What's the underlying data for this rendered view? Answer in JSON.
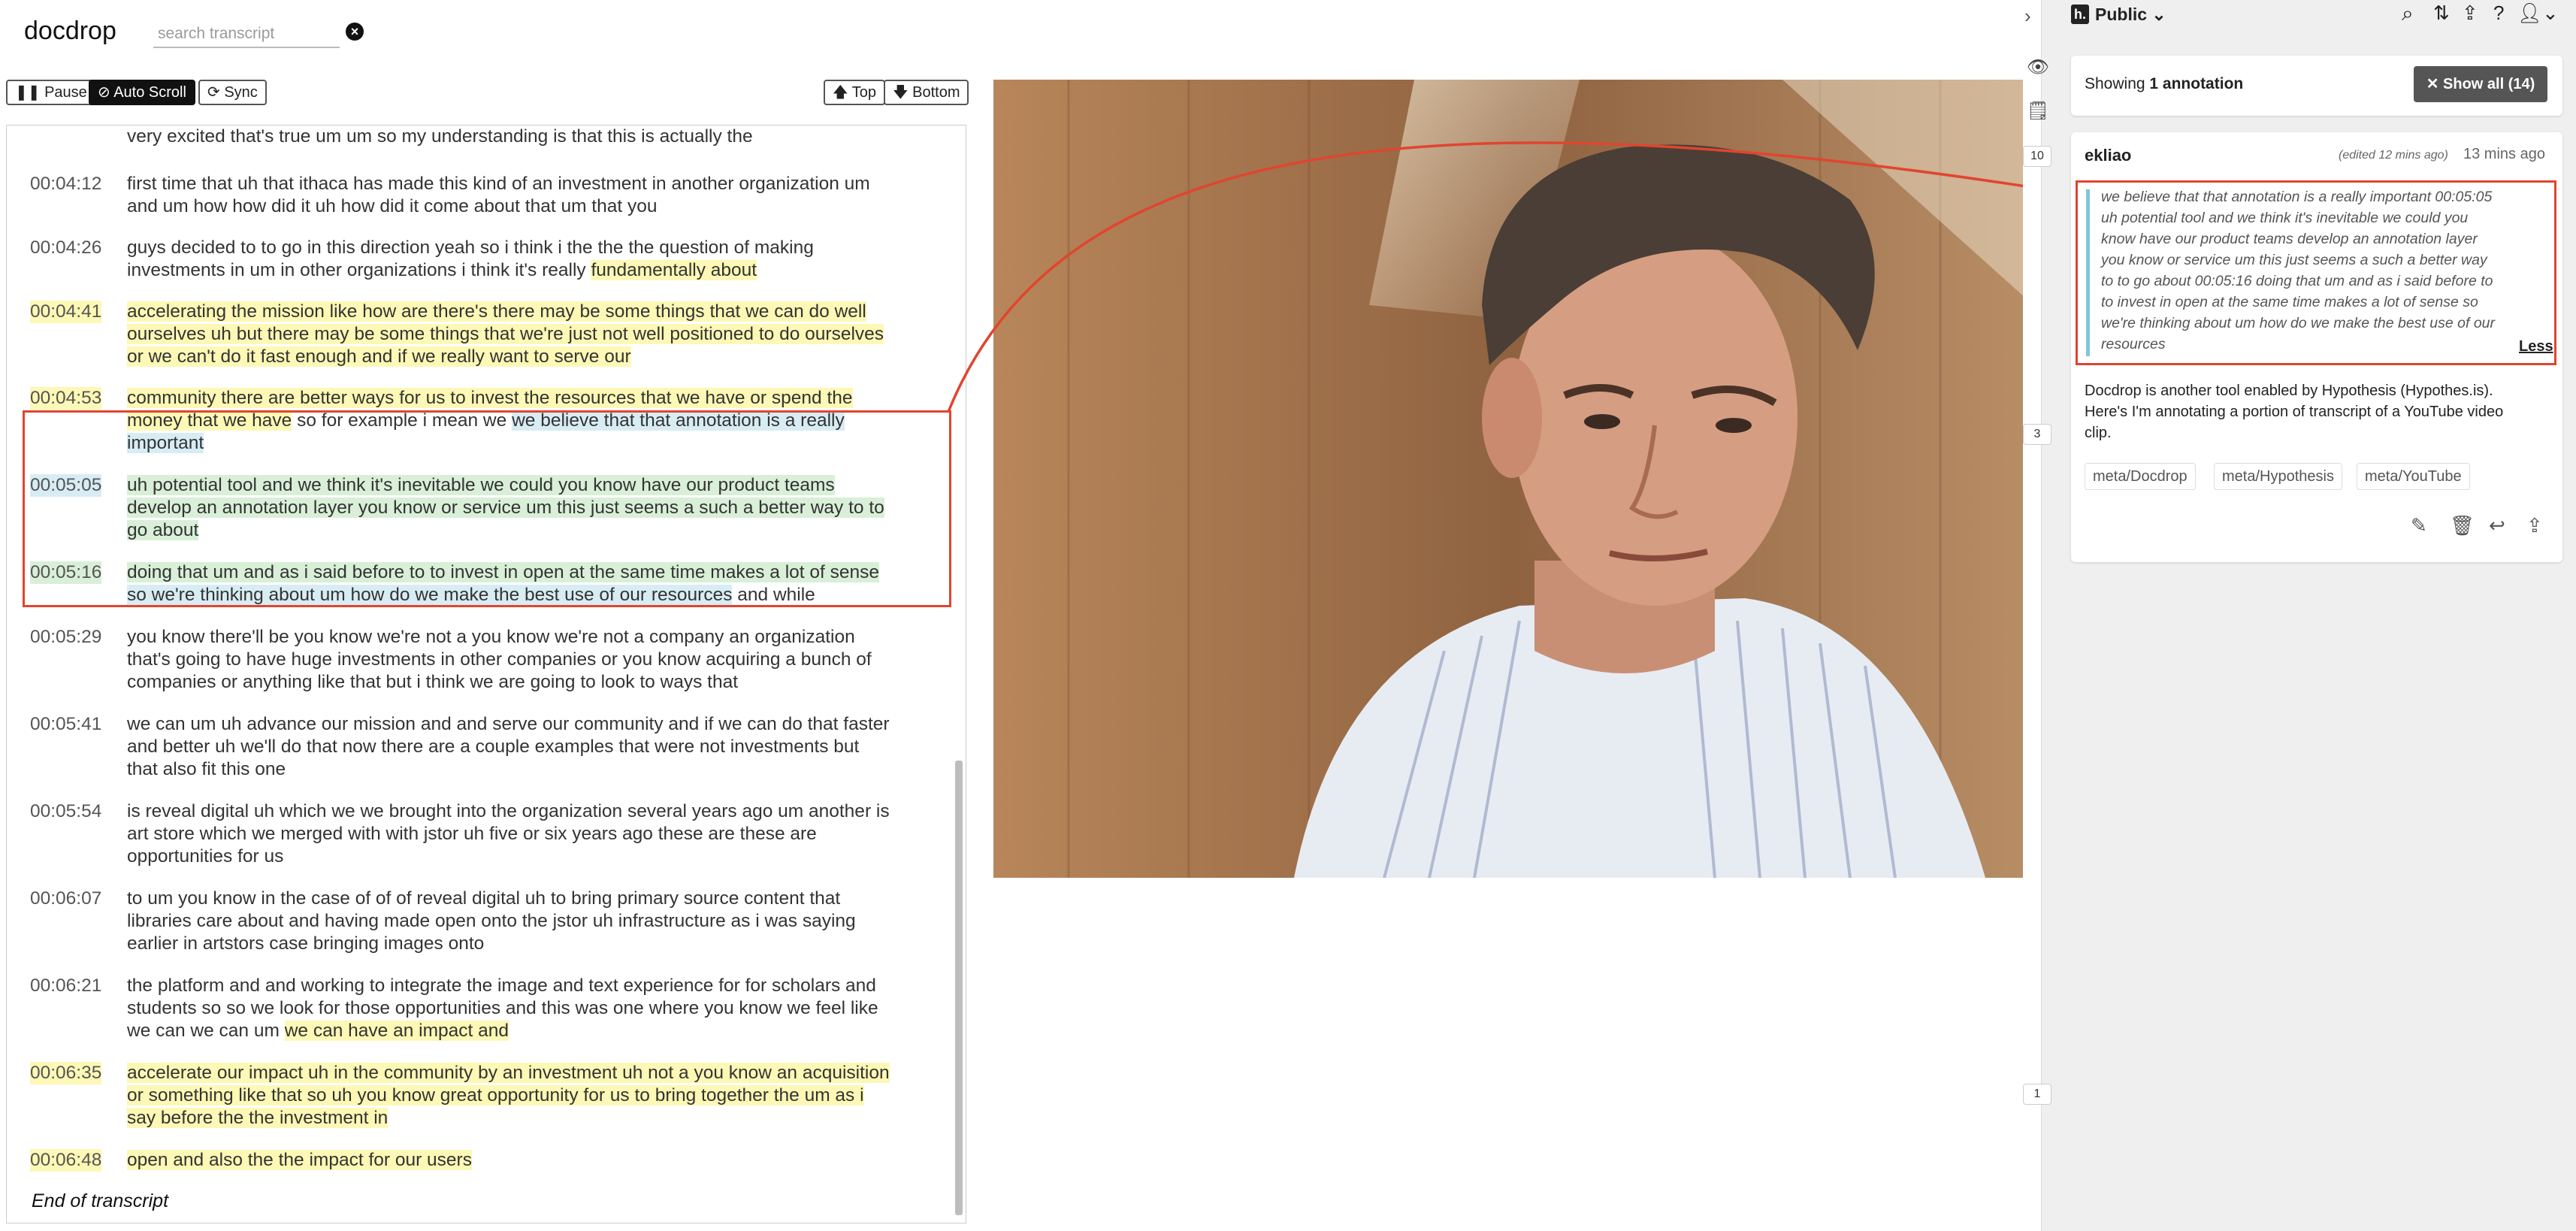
{
  "app": {
    "title": "docdrop",
    "search_placeholder": "search transcript"
  },
  "controls": {
    "pause": "Pause",
    "auto_scroll": "Auto Scroll",
    "sync": "Sync",
    "top": "Top",
    "bottom": "Bottom"
  },
  "transcript": {
    "partial_line": "very excited that's true um um so my understanding is that this is actually the",
    "segments": [
      {
        "time": "00:04:12",
        "lines": [
          "first time that uh that ithaca has made this kind of an investment in another organization um",
          "and um how how did it uh how did it come about that um that you"
        ]
      },
      {
        "time": "00:04:26",
        "lines": [
          "guys decided to to go in this direction yeah so i think i the the the question of making",
          "investments in um in other organizations i think it's really fundamentally about"
        ]
      },
      {
        "time": "00:04:41",
        "lines": [
          "accelerating the mission like how are there's there may be some things that we can do well",
          "ourselves uh but there may be some things that we're just not well positioned to do ourselves",
          "or we can't do it fast enough and if we really want to serve our"
        ]
      },
      {
        "time": "00:04:53",
        "lines": [
          "community there are better ways for us to invest the resources that we have or spend the",
          "money that we have so for example i mean we we believe that that annotation is a really",
          "important"
        ]
      },
      {
        "time": "00:05:05",
        "lines": [
          "uh potential tool and we think it's inevitable we could you know have our product teams",
          "develop an annotation layer you know or service um this just seems a such a better way to to",
          "go about"
        ]
      },
      {
        "time": "00:05:16",
        "lines": [
          "doing that um and as i said before to to invest in open at the same time makes a lot of sense",
          "so we're thinking about um how do we make the best use of our resources and while"
        ]
      },
      {
        "time": "00:05:29",
        "lines": [
          "you know there'll be you know we're not a you know we're not a company an organization",
          "that's going to have huge investments in other companies or you know acquiring a bunch of",
          "companies or anything like that but i think we are going to look to ways that"
        ]
      },
      {
        "time": "00:05:41",
        "lines": [
          "we can um uh advance our mission and and serve our community and if we can do that faster",
          "and better uh we'll do that now there are a couple examples that were not investments but",
          "that also fit this one"
        ]
      },
      {
        "time": "00:05:54",
        "lines": [
          "is reveal digital uh which we we brought into the organization several years ago um another is",
          "art store which we merged with with jstor uh five or six years ago these are these are",
          "opportunities for us"
        ]
      },
      {
        "time": "00:06:07",
        "lines": [
          "to um you know in the case of of of reveal digital uh to bring primary source content that",
          "libraries care about and having made open onto the jstor uh infrastructure as i was saying",
          "earlier in artstors case bringing images onto"
        ]
      },
      {
        "time": "00:06:21",
        "lines": [
          "the platform and and working to integrate the image and text experience for for scholars and",
          "students so so we look for those opportunities and this was one where you know we feel like",
          "we can we can um we can have an impact and"
        ]
      },
      {
        "time": "00:06:35",
        "lines": [
          "accelerate our impact uh in the community by an investment uh not a you know an acquisition",
          "or something like that so uh you know great opportunity for us to bring together the um as i",
          "say before the the investment in"
        ]
      },
      {
        "time": "00:06:48",
        "lines": [
          "open and also the the impact for our users"
        ]
      }
    ],
    "end_text": "End of transcript"
  },
  "sidebar": {
    "group": "Public",
    "showing_prefix": "Showing ",
    "showing_count": "1 annotation",
    "show_all": "Show all (14)",
    "annotation": {
      "user": "ekliao",
      "edited": "(edited 12 mins ago)",
      "time": "13 mins ago",
      "quote_lines": [
        "we believe that that annotation is a really important 00:05:05",
        "uh potential tool and we think it's inevitable we could you",
        "know have our product teams develop an annotation layer",
        "you know or service um this just seems a such a better way",
        "to to go about 00:05:16 doing that um and as i said before to",
        "to invest in open at the same time makes a lot of sense so",
        "we're thinking about um how do we make the best use of our",
        "resources"
      ],
      "less": "Less",
      "body_lines": [
        "Docdrop is another tool enabled by Hypothesis (Hypothes.is).",
        "Here's I'm annotating a portion of transcript of a YouTube video",
        "clip."
      ],
      "tags": [
        "meta/Docdrop",
        "meta/Hypothesis",
        "meta/YouTube"
      ]
    },
    "bubbles": [
      "10",
      "3",
      "1"
    ]
  },
  "colors": {
    "highlight_yellow": "#fdf8b5",
    "highlight_blue": "#d8ecf4",
    "highlight_green": "#d9efd8",
    "callout_red": "#e0452f"
  }
}
